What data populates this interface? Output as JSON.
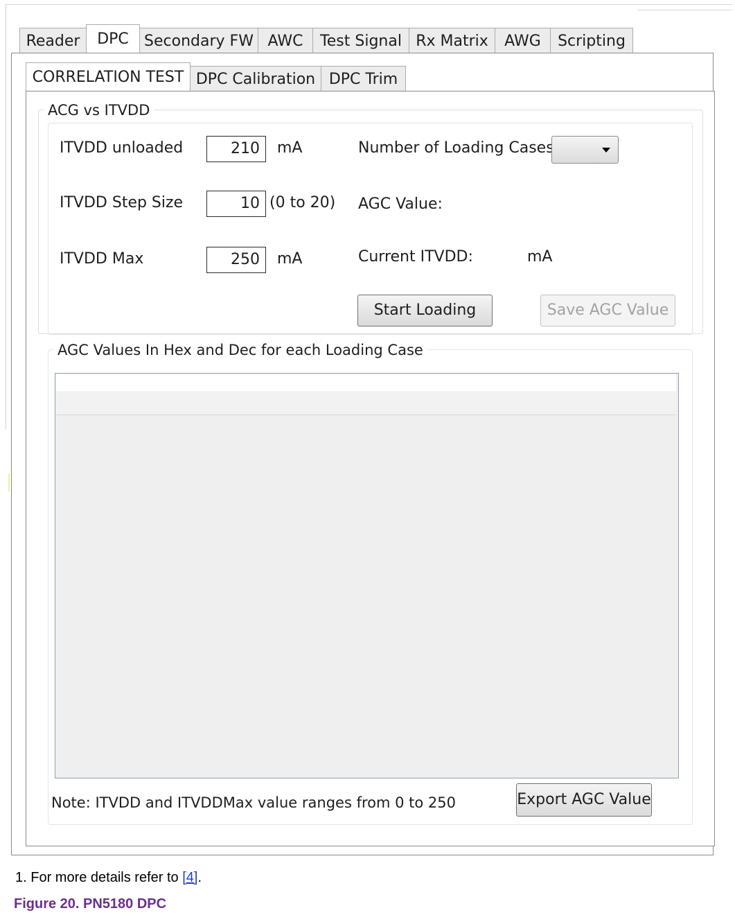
{
  "main_tabs": [
    {
      "label": "Reader",
      "selected": false
    },
    {
      "label": "DPC",
      "selected": true
    },
    {
      "label": "Secondary FW",
      "selected": false
    },
    {
      "label": "AWC",
      "selected": false
    },
    {
      "label": "Test Signal",
      "selected": false
    },
    {
      "label": "Rx Matrix",
      "selected": false
    },
    {
      "label": "AWG",
      "selected": false
    },
    {
      "label": "Scripting",
      "selected": false
    }
  ],
  "sub_tabs": [
    {
      "label": "CORRELATION TEST",
      "selected": true
    },
    {
      "label": "DPC Calibration",
      "selected": false
    },
    {
      "label": "DPC Trim",
      "selected": false
    }
  ],
  "acg_group": {
    "title": "ACG vs ITVDD",
    "itvdd_unloaded": {
      "label": "ITVDD unloaded",
      "value": "210",
      "unit": "mA"
    },
    "itvdd_step_size": {
      "label": "ITVDD Step Size",
      "value": "10",
      "range": "(0 to 20)"
    },
    "itvdd_max": {
      "label": "ITVDD Max",
      "value": "250",
      "unit": "mA"
    },
    "loading_cases": {
      "label": "Number of Loading Cases",
      "value": ""
    },
    "agc_value": {
      "label": "AGC Value:",
      "value": ""
    },
    "current_itvdd": {
      "label": "Current ITVDD:",
      "unit": "mA"
    },
    "start_loading_button": "Start Loading",
    "save_agc_button": "Save AGC Value",
    "save_agc_enabled": false
  },
  "agc_values_group": {
    "title": "AGC Values In Hex and Dec for each Loading Case",
    "rows": [],
    "note": "Note: ITVDD and ITVDDMax value ranges from 0 to 250",
    "export_button": "Export AGC Value"
  },
  "footnote": {
    "prefix": "1.  For more details refer to ",
    "ref": "[4]",
    "suffix": "."
  },
  "caption": "Figure 20.  PN5180 DPC"
}
